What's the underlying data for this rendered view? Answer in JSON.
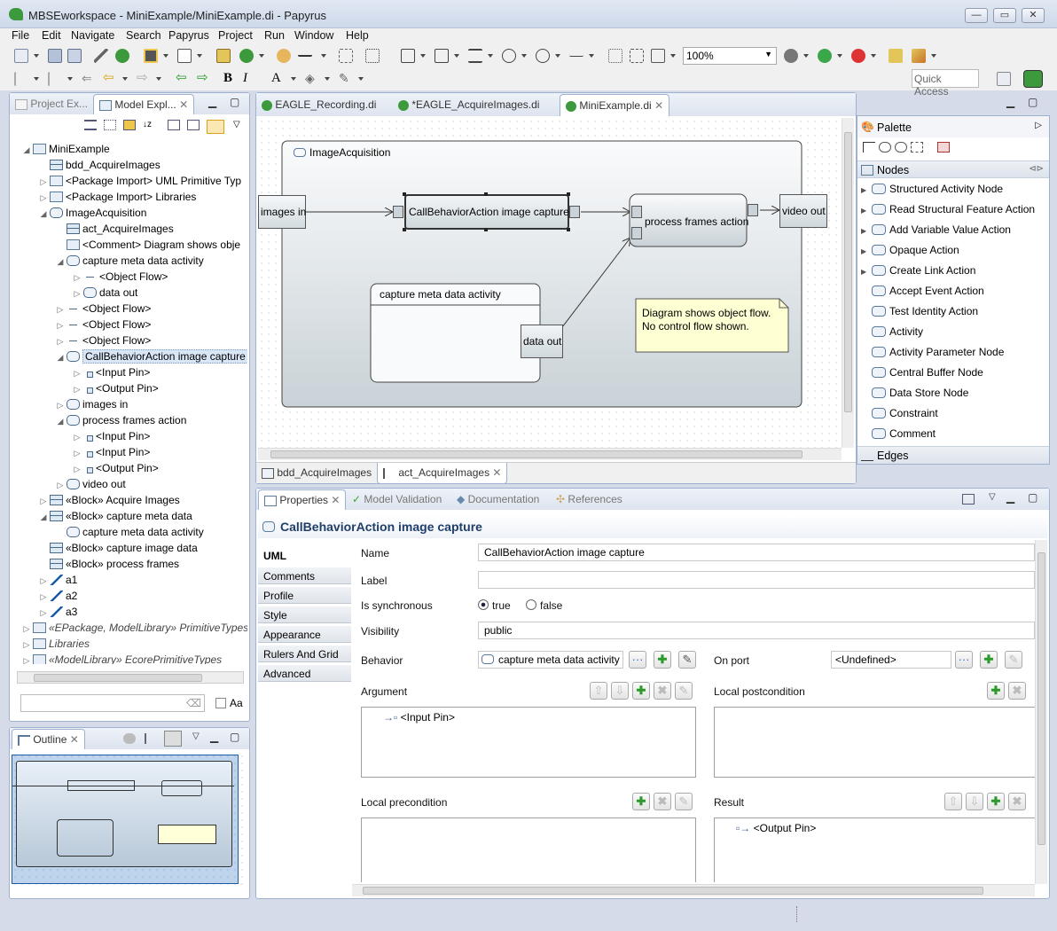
{
  "window": {
    "title": "MBSEworkspace - MiniExample/MiniExample.di - Papyrus"
  },
  "menu": [
    "File",
    "Edit",
    "Navigate",
    "Search",
    "Papyrus",
    "Project",
    "Run",
    "Window",
    "Help"
  ],
  "toolbar": {
    "zoom": "100%",
    "quick_access": "Quick Access"
  },
  "explorer": {
    "tabs": [
      "Project Ex...",
      "Model Expl..."
    ],
    "tree": [
      {
        "label": "MiniExample",
        "depth": 0,
        "tw": "open",
        "icon": "pkg"
      },
      {
        "label": "bdd_AcquireImages",
        "depth": 1,
        "tw": "",
        "icon": "diagram"
      },
      {
        "label": "<Package Import> UML Primitive Typ",
        "depth": 1,
        "tw": "closed",
        "icon": "import"
      },
      {
        "label": "<Package Import> Libraries",
        "depth": 1,
        "tw": "closed",
        "icon": "import"
      },
      {
        "label": "ImageAcquisition",
        "depth": 1,
        "tw": "open",
        "icon": "act"
      },
      {
        "label": "act_AcquireImages",
        "depth": 2,
        "tw": "",
        "icon": "diagram"
      },
      {
        "label": "<Comment> Diagram shows obje",
        "depth": 2,
        "tw": "",
        "icon": "comment"
      },
      {
        "label": "capture meta data activity",
        "depth": 2,
        "tw": "open",
        "icon": "act"
      },
      {
        "label": "<Object Flow>",
        "depth": 3,
        "tw": "closed",
        "icon": "flow"
      },
      {
        "label": "data out",
        "depth": 3,
        "tw": "closed",
        "icon": "param"
      },
      {
        "label": "<Object Flow>",
        "depth": 2,
        "tw": "closed",
        "icon": "flow"
      },
      {
        "label": "<Object Flow>",
        "depth": 2,
        "tw": "closed",
        "icon": "flow"
      },
      {
        "label": "<Object Flow>",
        "depth": 2,
        "tw": "closed",
        "icon": "flow"
      },
      {
        "label": "CallBehaviorAction image capture",
        "depth": 2,
        "tw": "open",
        "icon": "act",
        "selected": true
      },
      {
        "label": "<Input Pin>",
        "depth": 3,
        "tw": "closed",
        "icon": "pin"
      },
      {
        "label": "<Output Pin>",
        "depth": 3,
        "tw": "closed",
        "icon": "pin"
      },
      {
        "label": "images in",
        "depth": 2,
        "tw": "closed",
        "icon": "param"
      },
      {
        "label": "process frames action",
        "depth": 2,
        "tw": "open",
        "icon": "opaque"
      },
      {
        "label": "<Input Pin>",
        "depth": 3,
        "tw": "closed",
        "icon": "pin"
      },
      {
        "label": "<Input Pin>",
        "depth": 3,
        "tw": "closed",
        "icon": "pin"
      },
      {
        "label": "<Output Pin>",
        "depth": 3,
        "tw": "closed",
        "icon": "pin"
      },
      {
        "label": "video out",
        "depth": 2,
        "tw": "closed",
        "icon": "param"
      },
      {
        "label": "«Block» Acquire Images",
        "depth": 1,
        "tw": "closed",
        "icon": "blk"
      },
      {
        "label": "«Block» capture meta data",
        "depth": 1,
        "tw": "open",
        "icon": "blk"
      },
      {
        "label": "capture meta data activity",
        "depth": 2,
        "tw": "",
        "icon": "act"
      },
      {
        "label": "«Block» capture image data",
        "depth": 1,
        "tw": "",
        "icon": "blk"
      },
      {
        "label": "«Block» process frames",
        "depth": 1,
        "tw": "",
        "icon": "blk"
      },
      {
        "label": "a1",
        "depth": 1,
        "tw": "closed",
        "icon": "assoc"
      },
      {
        "label": "a2",
        "depth": 1,
        "tw": "closed",
        "icon": "assoc"
      },
      {
        "label": "a3",
        "depth": 1,
        "tw": "closed",
        "icon": "assoc"
      },
      {
        "label": "«EPackage, ModelLibrary» PrimitiveTypes",
        "depth": 0,
        "tw": "closed",
        "icon": "pkg",
        "italic": true
      },
      {
        "label": "Libraries",
        "depth": 0,
        "tw": "closed",
        "icon": "pkg",
        "italic": true
      },
      {
        "label": "«ModelLibrary» EcorePrimitiveTypes",
        "depth": 0,
        "tw": "closed",
        "icon": "pkg",
        "italic": true
      }
    ],
    "filter_case_label": "Aa"
  },
  "outline": {
    "tab": "Outline"
  },
  "editor": {
    "tabs": [
      "EAGLE_Recording.di",
      "*EAGLE_AcquireImages.di",
      "MiniExample.di"
    ],
    "bottom_tabs": [
      "bdd_AcquireImages",
      "act_AcquireImages"
    ],
    "diagram": {
      "activity_title": "ImageAcquisition",
      "images_in": "images in",
      "capture_action": "CallBehaviorAction image capture",
      "process_action": "process frames action",
      "video_out": "video out",
      "meta_activity": "capture meta data activity",
      "data_out": "data out",
      "comment_line1": "Diagram shows object flow.",
      "comment_line2": "No control flow shown."
    }
  },
  "palette": {
    "title": "Palette",
    "nodes_header": "Nodes",
    "edges_header": "Edges",
    "items": [
      "Structured Activity Node",
      "Read Structural Feature Action",
      "Add Variable Value Action",
      "Opaque Action",
      "Create Link Action",
      "Accept Event Action",
      "Test Identity Action",
      "Activity",
      "Activity Parameter Node",
      "Central Buffer Node",
      "Data Store Node",
      "Constraint",
      "Comment"
    ]
  },
  "properties": {
    "tabs": [
      "Properties",
      "Model Validation",
      "Documentation",
      "References"
    ],
    "heading": "CallBehaviorAction image capture",
    "side_tabs": [
      "UML",
      "Comments",
      "Profile",
      "Style",
      "Appearance",
      "Rulers And Grid",
      "Advanced"
    ],
    "name_label": "Name",
    "name_value": "CallBehaviorAction image capture",
    "label_label": "Label",
    "label_value": "",
    "sync_label": "Is synchronous",
    "sync_true": "true",
    "sync_false": "false",
    "visibility_label": "Visibility",
    "visibility_value": "public",
    "behavior_label": "Behavior",
    "behavior_value": "capture meta data activity",
    "on_port_label": "On port",
    "on_port_value": "<Undefined>",
    "argument_label": "Argument",
    "argument_item": "<Input Pin>",
    "local_post_label": "Local postcondition",
    "local_pre_label": "Local precondition",
    "result_label": "Result",
    "result_item": "<Output Pin>"
  }
}
